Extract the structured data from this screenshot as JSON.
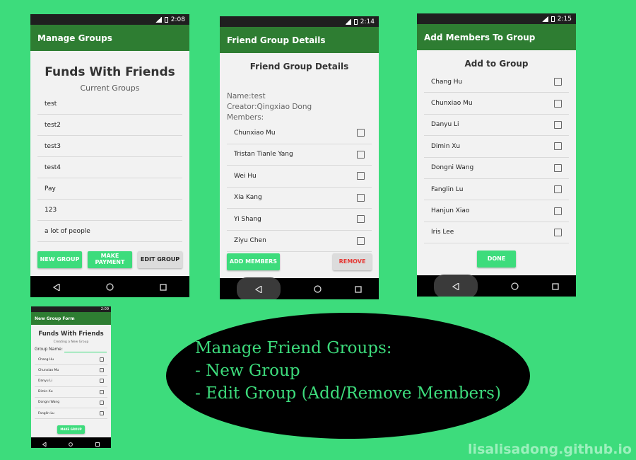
{
  "phone1": {
    "time": "2:08",
    "appbar_title": "Manage Groups",
    "heading": "Funds With Friends",
    "subheading": "Current Groups",
    "groups": [
      "test",
      "test2",
      "test3",
      "test4",
      "Pay",
      "123",
      "a lot of people"
    ],
    "btn_new": "NEW GROUP",
    "btn_pay": "MAKE PAYMENT",
    "btn_edit": "EDIT GROUP"
  },
  "phone2": {
    "time": "2:14",
    "appbar_title": "Friend Group Details",
    "heading": "Friend Group Details",
    "name_line": "Name:test",
    "creator_line": "Creator:Qingxiao Dong",
    "members_label": "Members:",
    "members": [
      "Chunxiao Mu",
      "Tristan Tianle Yang",
      "Wei Hu",
      "Xia Kang",
      "Yi Shang",
      "Ziyu Chen"
    ],
    "btn_add": "ADD MEMBERS",
    "btn_remove": "REMOVE"
  },
  "phone3": {
    "time": "2:15",
    "appbar_title": "Add Members To Group",
    "heading": "Add to Group",
    "people": [
      "Chang Hu",
      "Chunxiao Mu",
      "Danyu Li",
      "Dimin Xu",
      "Dongni Wang",
      "Fanglin Lu",
      "Hanjun Xiao",
      "Iris Lee"
    ],
    "btn_done": "DONE"
  },
  "phone4": {
    "time": "2:09",
    "appbar_title": "New Group Form",
    "heading": "Funds With Friends",
    "subheading": "Creating a New Group",
    "group_name_label": "Group Name:",
    "people": [
      "Chang Hu",
      "Chunxiao Mu",
      "Danyu Li",
      "Dimin Xu",
      "Dongni Wang",
      "Fanglin Lu"
    ],
    "btn_make": "MAKE GROUP"
  },
  "caption": {
    "line1": "Manage Friend Groups:",
    "line2": "- New Group",
    "line3": "- Edit Group (Add/Remove Members)"
  },
  "watermark": "lisalisadong.github.io",
  "colors": {
    "background": "#3ddc7c",
    "appbar": "#2e7d32",
    "button": "#3ddc7c",
    "remove_text": "#e53935"
  }
}
